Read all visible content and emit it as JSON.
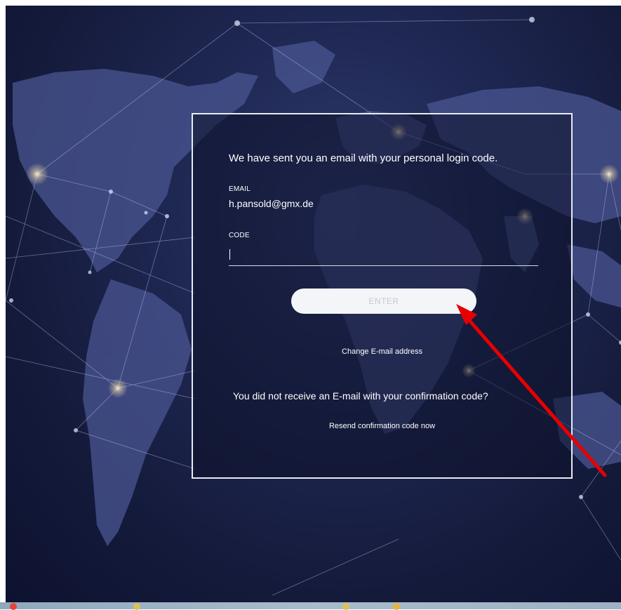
{
  "login": {
    "intro_text": "We have sent you an email with your personal login code.",
    "email_label": "EMAIL",
    "email_value": "h.pansold@gmx.de",
    "code_label": "CODE",
    "code_value": "",
    "enter_label": "ENTER",
    "change_email_label": "Change E-mail address",
    "resend_question": "You did not receive an E-mail with your confirmation code?",
    "resend_label": "Resend confirmation code now"
  },
  "colors": {
    "background_dark": "#141a3a",
    "panel_border": "#e8ebf2",
    "button_bg": "#f4f5f8",
    "button_text": "#c5c8d2",
    "annotation_arrow": "#e60000"
  },
  "icons": {
    "annotation": "red-arrow-icon"
  }
}
